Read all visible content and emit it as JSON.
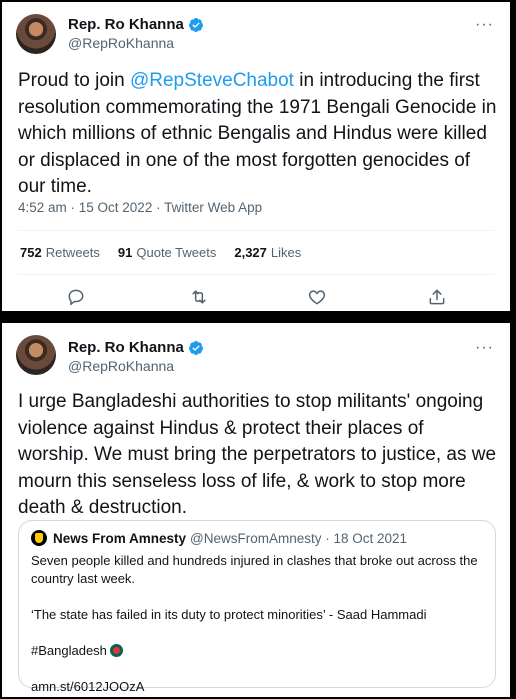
{
  "tweet1": {
    "author_name": "Rep. Ro Khanna",
    "author_handle": "@RepRoKhanna",
    "text_before": "Proud to join ",
    "mention": "@RepSteveChabot",
    "text_after": " in introducing the first resolution commemorating the 1971 Bengali Genocide in which millions of ethnic Bengalis and Hindus were killed or displaced in one of the most forgotten genocides of our time.",
    "timestamp": "4:52 am · 15 Oct 2022 · Twitter Web App",
    "stats": {
      "retweets_count": "752",
      "retweets_label": "Retweets",
      "quotes_count": "91",
      "quotes_label": "Quote Tweets",
      "likes_count": "2,327",
      "likes_label": "Likes"
    },
    "more": "···"
  },
  "tweet2": {
    "author_name": "Rep. Ro Khanna",
    "author_handle": "@RepRoKhanna",
    "text": "I urge Bangladeshi authorities to stop militants' ongoing violence against Hindus & protect their places of worship. We must bring the perpetrators to justice, as we mourn this senseless loss of life, & work to stop more death & destruction.",
    "more": "···",
    "quote": {
      "author_name": "News From Amnesty",
      "author_meta": "@NewsFromAmnesty · 18 Oct 2021",
      "line1": "Seven people killed and hundreds injured in clashes that broke out across the country last week.",
      "line2": "‘The state has failed in its duty to protect minorities’ - Saad Hammadi",
      "hashtag": "#Bangladesh",
      "link": "amn.st/6012JOOzA"
    }
  },
  "icons": [
    "verified-badge-icon",
    "more-icon",
    "reply-icon",
    "retweet-icon",
    "like-icon",
    "share-icon",
    "flag-bangladesh-icon"
  ],
  "colors": {
    "accent": "#1d9bf0",
    "text": "#0f1419",
    "muted": "#536471",
    "border": "#cfd9de"
  }
}
